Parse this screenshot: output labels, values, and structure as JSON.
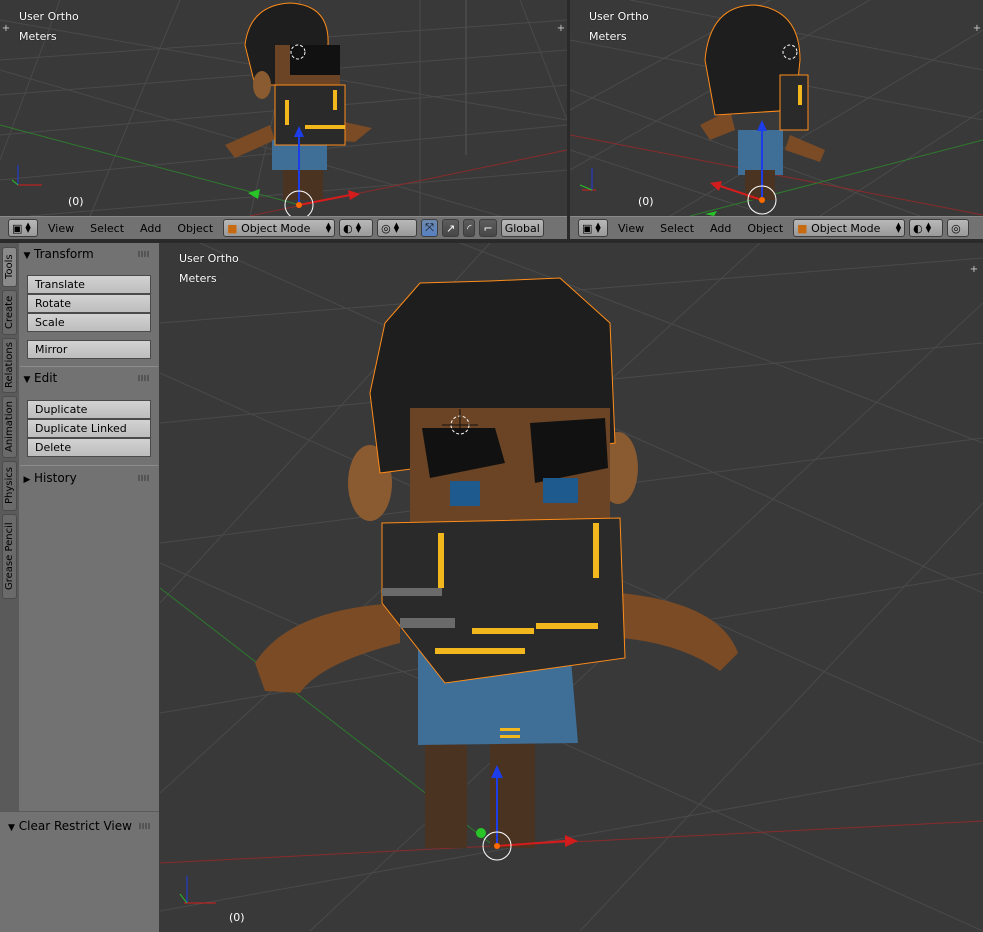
{
  "viewports": [
    {
      "name": "top-left",
      "view_label": "User Ortho",
      "units_label": "Meters",
      "frame": "(0)"
    },
    {
      "name": "top-right",
      "view_label": "User Ortho",
      "units_label": "Meters",
      "frame": "(0)"
    },
    {
      "name": "main",
      "view_label": "User Ortho",
      "units_label": "Meters",
      "frame": "(0)"
    }
  ],
  "header_left": {
    "view": "View",
    "select": "Select",
    "add": "Add",
    "object": "Object",
    "mode": "Object Mode",
    "orientation": "Global"
  },
  "header_right": {
    "view": "View",
    "select": "Select",
    "add": "Add",
    "object": "Object",
    "mode": "Object Mode"
  },
  "tabs": [
    "Tools",
    "Create",
    "Relations",
    "Animation",
    "Physics",
    "Grease Pencil"
  ],
  "transform": {
    "title": "Transform",
    "translate": "Translate",
    "rotate": "Rotate",
    "scale": "Scale",
    "mirror": "Mirror"
  },
  "edit": {
    "title": "Edit",
    "duplicate": "Duplicate",
    "duplicate_linked": "Duplicate Linked",
    "delete": "Delete"
  },
  "history": {
    "title": "History"
  },
  "operator_panel": {
    "title": "Clear Restrict View"
  },
  "colors": {
    "viewport_bg": "#393939",
    "grid": "#4a4a4a",
    "x_axis": "#8a2b2b",
    "y_axis": "#2e7a2e",
    "selection_outline": "#ff8c1a",
    "shelf_bg": "#727272"
  }
}
